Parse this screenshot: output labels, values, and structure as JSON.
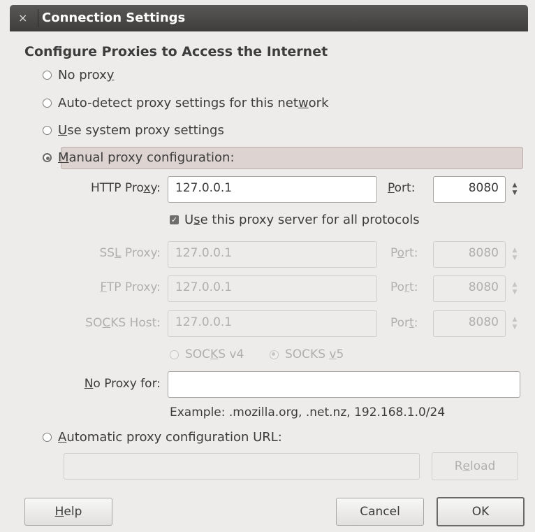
{
  "window": {
    "title": "Connection Settings",
    "close_symbol": "×"
  },
  "heading": "Configure Proxies to Access the Internet",
  "options": {
    "no_proxy": {
      "pre": "No prox",
      "u": "y",
      "post": ""
    },
    "auto_detect": {
      "pre": "Auto-detect proxy settings for this net",
      "u": "w",
      "post": "ork"
    },
    "system": {
      "pre": "",
      "u": "U",
      "post": "se system proxy settings"
    },
    "manual": {
      "pre": "",
      "u": "M",
      "post": "anual proxy configuration:"
    },
    "auto_url": {
      "pre": "",
      "u": "A",
      "post": "utomatic proxy configuration URL:"
    }
  },
  "http": {
    "label_pre": "HTTP Pro",
    "label_u": "x",
    "label_post": "y:",
    "value": "127.0.0.1",
    "port_u": "P",
    "port_post": "ort:",
    "port": "8080"
  },
  "use_all": {
    "pre": "U",
    "u": "s",
    "post": "e this proxy server for all protocols"
  },
  "ssl": {
    "label_pre": "SS",
    "label_u": "L",
    "label_post": " Proxy:",
    "value": "127.0.0.1",
    "port_pre": "P",
    "port_u": "o",
    "port_post": "rt:",
    "port": "8080"
  },
  "ftp": {
    "label_pre": "",
    "label_u": "F",
    "label_post": "TP Proxy:",
    "value": "127.0.0.1",
    "port_pre": "Po",
    "port_u": "r",
    "port_post": "t:",
    "port": "8080"
  },
  "socks": {
    "label_pre": "SO",
    "label_u": "C",
    "label_post": "KS Host:",
    "value": "127.0.0.1",
    "port_pre": "Por",
    "port_u": "t",
    "port_post": ":",
    "port": "8080"
  },
  "socks_v4": {
    "pre": "SOC",
    "u": "K",
    "post": "S v4"
  },
  "socks_v5": {
    "pre": "SOCKS ",
    "u": "v",
    "post": "5"
  },
  "no_proxy_for": {
    "label_u": "N",
    "label_post": "o Proxy for:",
    "value": ""
  },
  "example": "Example: .mozilla.org, .net.nz, 192.168.1.0/24",
  "reload": {
    "pre": "R",
    "u": "e",
    "post": "load"
  },
  "buttons": {
    "help": {
      "u": "H",
      "post": "elp"
    },
    "cancel": "Cancel",
    "ok": "OK"
  },
  "spin_up": "▲",
  "spin_down": "▼",
  "check_mark": "✓"
}
